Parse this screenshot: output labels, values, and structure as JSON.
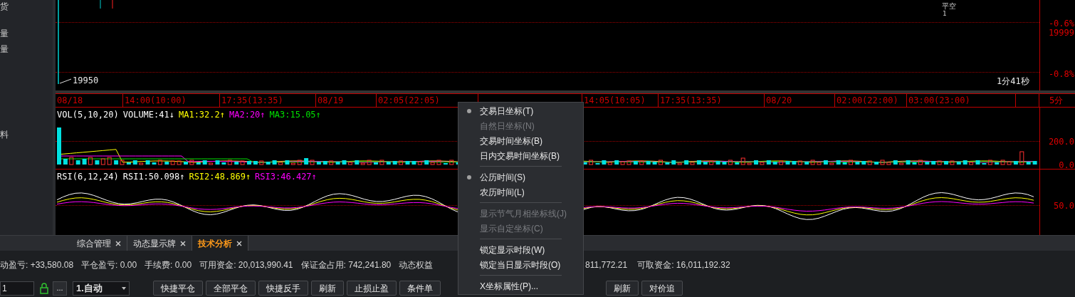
{
  "sidebar": {
    "items": [
      "货",
      "量",
      "量",
      "料"
    ]
  },
  "price_pane": {
    "trade_mark": {
      "label": "平空",
      "count": "1"
    },
    "low_label": "19950",
    "countdown": "1分41秒",
    "axis_labels": [
      "-0.6%",
      "19999",
      "-0.8%"
    ]
  },
  "time_axis": {
    "labels": [
      "08/18",
      "14:00(10:00)",
      "17:35(13:35)",
      "08/19",
      "02:05(22:05)",
      "14:05(10:05)",
      "17:35(13:35)",
      "08/20",
      "02:00(22:00)",
      "03:00(23:00)"
    ],
    "period": "5分"
  },
  "volume_pane": {
    "legend": [
      {
        "text": "VOL(5,10,20)",
        "color": "#ffffff"
      },
      {
        "text": "VOLUME:41↓",
        "color": "#ffffff"
      },
      {
        "text": "MA1:32.2↑",
        "color": "#ffff00"
      },
      {
        "text": "MA2:20↑",
        "color": "#ff00ff"
      },
      {
        "text": "MA3:15.05↑",
        "color": "#00e000"
      }
    ],
    "axis_labels": [
      "200.0",
      "0.0"
    ]
  },
  "rsi_pane": {
    "legend": [
      {
        "text": "RSI(6,12,24)",
        "color": "#ffffff"
      },
      {
        "text": "RSI1:50.098↑",
        "color": "#ffffff"
      },
      {
        "text": "RSI2:48.869↑",
        "color": "#ffff00"
      },
      {
        "text": "RSI3:46.427↑",
        "color": "#ff00ff"
      }
    ],
    "axis_labels": [
      "50.0"
    ]
  },
  "tabs": [
    {
      "label": "综合管理",
      "selected": false
    },
    {
      "label": "动态显示牌",
      "selected": false
    },
    {
      "label": "技术分析",
      "selected": true
    }
  ],
  "account_bar": {
    "items": [
      "动盈亏: +33,580.08",
      "平仓盈亏: 0.00",
      "手续费: 0.00",
      "可用资金: 20,013,990.41",
      "保证金占用: 742,241.80",
      "动态权益",
      "811,772.21",
      "可取资金: 16,011,192.32"
    ]
  },
  "toolbar": {
    "quantity": "1",
    "more": "...",
    "mode": "1.自动",
    "buttons": [
      "快捷平仓",
      "全部平仓",
      "快捷反手",
      "刷新",
      "止损止盈",
      "条件单",
      "刷新",
      "对价追"
    ]
  },
  "context_menu": {
    "items": [
      {
        "kind": "item",
        "label": "交易日坐标(T)",
        "checked": true,
        "disabled": false
      },
      {
        "kind": "item",
        "label": "自然日坐标(N)",
        "checked": false,
        "disabled": true
      },
      {
        "kind": "item",
        "label": "交易时间坐标(B)",
        "checked": false,
        "disabled": false
      },
      {
        "kind": "item",
        "label": "日内交易时间坐标(B)",
        "checked": false,
        "disabled": false
      },
      {
        "kind": "separator"
      },
      {
        "kind": "item",
        "label": "公历时间(S)",
        "checked": true,
        "disabled": false
      },
      {
        "kind": "item",
        "label": "农历时间(L)",
        "checked": false,
        "disabled": false
      },
      {
        "kind": "separator"
      },
      {
        "kind": "item",
        "label": "显示节气月相坐标线(J)",
        "checked": false,
        "disabled": true
      },
      {
        "kind": "item",
        "label": "显示自定坐标(C)",
        "checked": false,
        "disabled": true
      },
      {
        "kind": "separator"
      },
      {
        "kind": "item",
        "label": "锁定显示时段(W)",
        "checked": false,
        "disabled": false
      },
      {
        "kind": "item",
        "label": "锁定当日显示时段(O)",
        "checked": false,
        "disabled": false
      },
      {
        "kind": "separator"
      },
      {
        "kind": "item",
        "label": "X坐标属性(P)...",
        "checked": false,
        "disabled": false
      }
    ]
  }
}
